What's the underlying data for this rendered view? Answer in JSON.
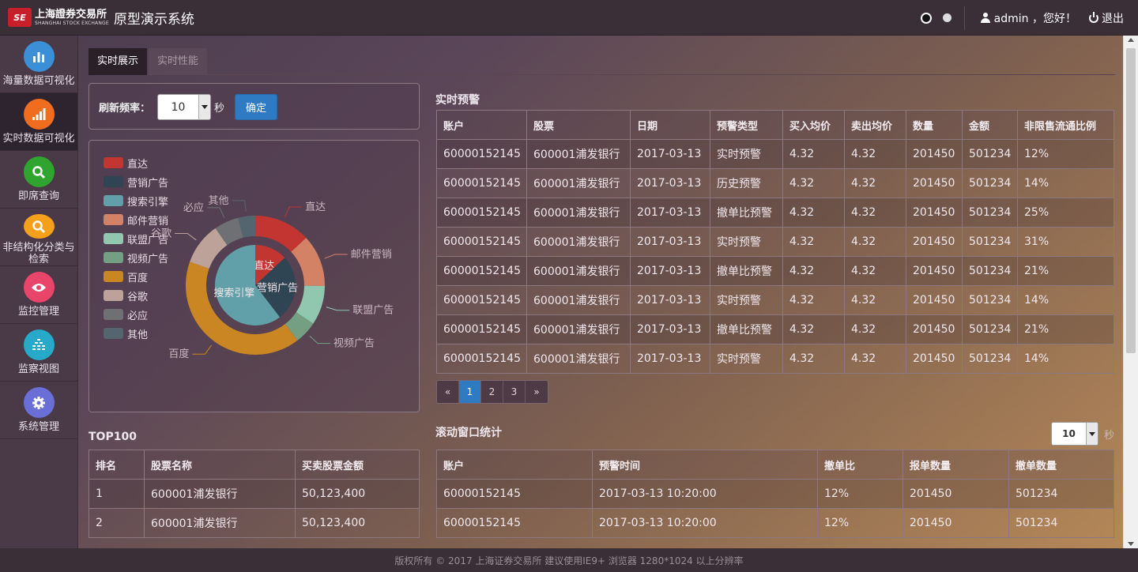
{
  "header": {
    "logo_cn": "上海證券交易所",
    "logo_en": "SHANGHAI STOCK EXCHANGE",
    "logo_mark": "SE",
    "title": "原型演示系统",
    "user_greeting": "admin ，您好！",
    "logout": "退出"
  },
  "sidebar": {
    "items": [
      {
        "label": "海量数据可视化",
        "icon": "bar-chart-icon",
        "color": "#3a8fd6"
      },
      {
        "label": "实时数据可视化",
        "icon": "signal-bars-icon",
        "color": "#f06c1e"
      },
      {
        "label": "即席查询",
        "icon": "search-icon",
        "color": "#2fa52f"
      },
      {
        "label": "非结构化分类与检索",
        "icon": "search-icon",
        "color": "#f5a01a"
      },
      {
        "label": "监控管理",
        "icon": "eye-icon",
        "color": "#e9446a"
      },
      {
        "label": "监察视图",
        "icon": "equalizer-icon",
        "color": "#27a9c9"
      },
      {
        "label": "系统管理",
        "icon": "gear-icon",
        "color": "#6a6fd8"
      }
    ]
  },
  "tabs": [
    "实时展示",
    "实时性能"
  ],
  "refresh": {
    "label": "刷新频率：",
    "value": "10",
    "unit": "秒",
    "confirm": "确定"
  },
  "chart_data": {
    "type": "pie",
    "legend": [
      "直达",
      "营销广告",
      "搜索引擎",
      "邮件营销",
      "联盟广告",
      "视频广告",
      "百度",
      "谷歌",
      "必应",
      "其他"
    ],
    "colors": [
      "#c23531",
      "#2f4554",
      "#61a0a8",
      "#d48265",
      "#91c7ae",
      "#749f83",
      "#ca8622",
      "#bda29a",
      "#6e7074",
      "#546570"
    ],
    "inner": [
      {
        "name": "直达",
        "value": 335
      },
      {
        "name": "营销广告",
        "value": 679
      },
      {
        "name": "搜索引擎",
        "value": 1548
      }
    ],
    "outer": [
      {
        "name": "直达",
        "value": 335
      },
      {
        "name": "邮件营销",
        "value": 310
      },
      {
        "name": "联盟广告",
        "value": 234
      },
      {
        "name": "视频广告",
        "value": 135
      },
      {
        "name": "百度",
        "value": 1048
      },
      {
        "name": "谷歌",
        "value": 251
      },
      {
        "name": "必应",
        "value": 147
      },
      {
        "name": "其他",
        "value": 102
      }
    ]
  },
  "alerts": {
    "title": "实时预警",
    "headers": [
      "账户",
      "股票",
      "日期",
      "预警类型",
      "买入均价",
      "卖出均价",
      "数量",
      "金额",
      "非限售流通比例"
    ],
    "rows": [
      [
        "60000152145",
        "600001浦发银行",
        "2017-03-13",
        "实时预警",
        "4.32",
        "4.32",
        "201450",
        "501234",
        "12%"
      ],
      [
        "60000152145",
        "600001浦发银行",
        "2017-03-13",
        "历史预警",
        "4.32",
        "4.32",
        "201450",
        "501234",
        "14%"
      ],
      [
        "60000152145",
        "600001浦发银行",
        "2017-03-13",
        "撤单比预警",
        "4.32",
        "4.32",
        "201450",
        "501234",
        "25%"
      ],
      [
        "60000152145",
        "600001浦发银行",
        "2017-03-13",
        "实时预警",
        "4.32",
        "4.32",
        "201450",
        "501234",
        "31%"
      ],
      [
        "60000152145",
        "600001浦发银行",
        "2017-03-13",
        "撤单比预警",
        "4.32",
        "4.32",
        "201450",
        "501234",
        "21%"
      ],
      [
        "60000152145",
        "600001浦发银行",
        "2017-03-13",
        "实时预警",
        "4.32",
        "4.32",
        "201450",
        "501234",
        "14%"
      ],
      [
        "60000152145",
        "600001浦发银行",
        "2017-03-13",
        "撤单比预警",
        "4.32",
        "4.32",
        "201450",
        "501234",
        "21%"
      ],
      [
        "60000152145",
        "600001浦发银行",
        "2017-03-13",
        "实时预警",
        "4.32",
        "4.32",
        "201450",
        "501234",
        "14%"
      ]
    ]
  },
  "pagination": {
    "prev": "«",
    "pages": [
      "1",
      "2",
      "3"
    ],
    "next": "»",
    "current": "1"
  },
  "top100": {
    "title": "TOP100",
    "headers": [
      "排名",
      "股票名称",
      "买卖股票金额"
    ],
    "rows": [
      [
        "1",
        "600001浦发银行",
        "50,123,400"
      ],
      [
        "2",
        "600001浦发银行",
        "50,123,400"
      ]
    ]
  },
  "window_stats": {
    "title": "滚动窗口统计",
    "select_value": "10",
    "unit": "秒",
    "headers": [
      "账户",
      "预警时间",
      "撤单比",
      "报单数量",
      "撤单数量"
    ],
    "rows": [
      [
        "60000152145",
        "2017-03-13 10:20:00",
        "12%",
        "201450",
        "501234"
      ],
      [
        "60000152145",
        "2017-03-13 10:20:00",
        "12%",
        "201450",
        "501234"
      ]
    ]
  },
  "footer": "版权所有 © 2017 上海证券交易所 建议使用IE9+ 浏览器 1280*1024 以上分辨率"
}
